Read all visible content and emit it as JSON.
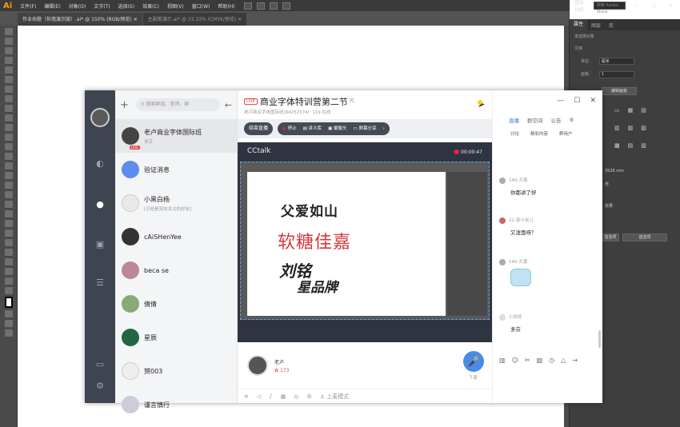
{
  "app": {
    "logo": "Ai"
  },
  "menubar": {
    "items": [
      "文件(F)",
      "编辑(E)",
      "对象(O)",
      "文字(T)",
      "选择(S)",
      "效果(C)",
      "视图(V)",
      "窗口(W)",
      "帮助(H)"
    ],
    "workspace": "基本功能",
    "search_placeholder": "搜索 Adobe Stock"
  },
  "doc_tabs": [
    {
      "label": "作业命题（拆墙演示版）.ai* @ 150% (RGB/预览)"
    },
    {
      "label": "主副笔演示.ai* @ 33.33% (CMYK/预览)"
    }
  ],
  "right_panel": {
    "tabs": [
      "属性",
      "图层",
      "库"
    ],
    "no_selection": "未选择对象",
    "doc_label": "文档",
    "unit_label": "单位：",
    "unit_value": "毫米",
    "artboard_label": "画板：",
    "artboard_value": "1",
    "edit_artboard": "编辑画板",
    "value1": "3526 mm",
    "text_a": "界",
    "text_b": "首选项",
    "text_c": "首选项",
    "text_d": "效果"
  },
  "cctalk": {
    "search_placeholder": "搜索群组、老师、群",
    "contacts": [
      {
        "name": "老卢商业字体国际班",
        "sub": "多芬",
        "live": "LIVE",
        "selected": true
      },
      {
        "name": "验证消息",
        "sub": ""
      },
      {
        "name": "小黑白杨",
        "sub": "[已经是双向关注的好友]"
      },
      {
        "name": "cAiSHenYee",
        "sub": ""
      },
      {
        "name": "beca se",
        "sub": ""
      },
      {
        "name": "倩倩",
        "sub": ""
      },
      {
        "name": "星辰",
        "sub": ""
      },
      {
        "name": "赟003",
        "sub": ""
      },
      {
        "name": "谨言慎行",
        "sub": ""
      }
    ],
    "live_badge": "LIVE",
    "title": "商业字体特训营第二节",
    "group_name": "老卢商业字体国际班",
    "group_id": "(84252574)",
    "online": "119 在线",
    "end_live": "结束直播",
    "controls": [
      "停止",
      "讲义库",
      "摄像头",
      "屏幕分享"
    ],
    "video_brand": "CCtalk",
    "rec_time": "00:00:47",
    "art_lines": [
      "父爱如山",
      "软糖佳嘉",
      "刘铭",
      "星品牌"
    ],
    "speaker": {
      "name": "老卢",
      "flowers": "173"
    },
    "mic_label": "下麦",
    "bottom_mode": "上麦模式",
    "right_tabs": [
      "直播",
      "群空间",
      "公告"
    ],
    "right_subtabs": [
      "讨论",
      "精彩内容",
      "群用户"
    ],
    "messages": [
      {
        "name": "140-大喜",
        "text": "你都讲了好"
      },
      {
        "name": "22-郭小米儿",
        "text": "又泼面呀？"
      },
      {
        "name": "140-大喜",
        "text": ""
      },
      {
        "name": "小欢欢",
        "text": "多芬"
      }
    ]
  }
}
